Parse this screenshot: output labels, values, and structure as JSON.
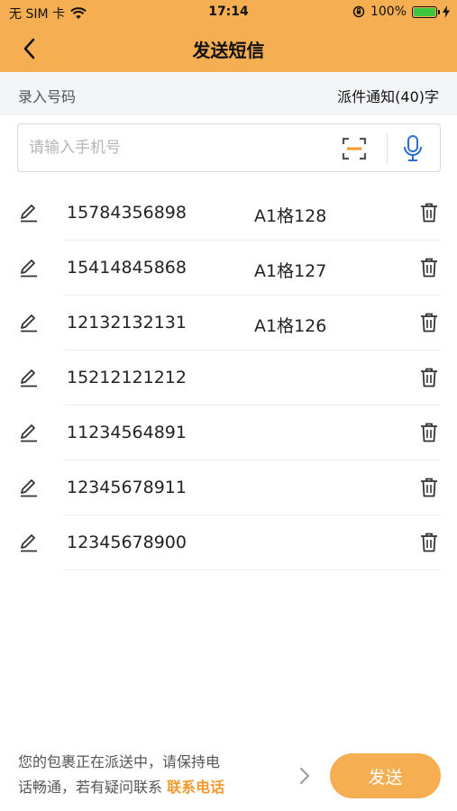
{
  "status_bar": {
    "carrier": "无 SIM 卡",
    "time": "17:14",
    "battery": "100%",
    "battery_level": 1.0
  },
  "nav": {
    "title": "发送短信",
    "back_icon": "chevron-left-icon"
  },
  "subbar": {
    "left_label": "录入号码",
    "template_label": "派件通知(40)字"
  },
  "search": {
    "placeholder": "请输入手机号",
    "value": "",
    "scan_icon": "scan-icon",
    "mic_icon": "microphone-icon"
  },
  "recipients": [
    {
      "phone": "15784356898",
      "tag": "A1格128"
    },
    {
      "phone": "15414845868",
      "tag": "A1格127"
    },
    {
      "phone": "12132132131",
      "tag": "A1格126"
    },
    {
      "phone": "15212121212",
      "tag": ""
    },
    {
      "phone": "11234564891",
      "tag": ""
    },
    {
      "phone": "12345678911",
      "tag": ""
    },
    {
      "phone": "12345678900",
      "tag": ""
    }
  ],
  "footer": {
    "message_line1": "您的包裹正在派送中，请保持电",
    "message_line2": "话畅通，若有疑问联系",
    "message_highlight": "联系电话",
    "send_label": "发送"
  },
  "colors": {
    "accent": "#F6AE52",
    "highlight": "#F29A2E",
    "mic_blue": "#2A6FD6"
  }
}
